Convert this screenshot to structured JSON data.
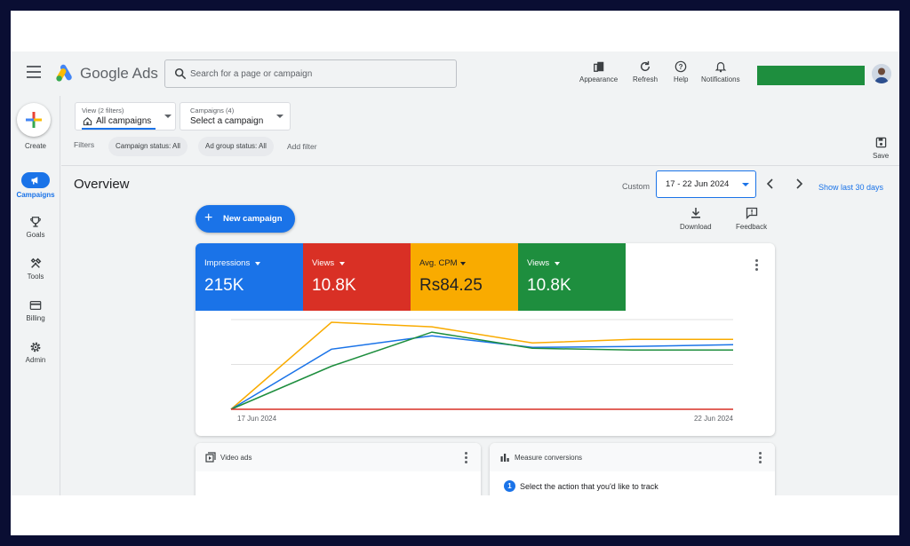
{
  "colors": {
    "accent": "#1a73e8",
    "impressions": "#1a73e8",
    "views_red": "#d93025",
    "avg_cpm": "#f9ab00",
    "views_green": "#1e8e3e"
  },
  "header": {
    "brand": "Google Ads",
    "search_placeholder": "Search for a page or campaign",
    "actions": [
      {
        "label": "Appearance",
        "icon": "appearance-icon"
      },
      {
        "label": "Refresh",
        "icon": "refresh-icon"
      },
      {
        "label": "Help",
        "icon": "help-icon"
      },
      {
        "label": "Notifications",
        "icon": "bell-icon"
      }
    ]
  },
  "leftnav": {
    "create": "Create",
    "items": [
      {
        "label": "Campaigns",
        "icon": "megaphone-icon",
        "active": true
      },
      {
        "label": "Goals",
        "icon": "trophy-icon"
      },
      {
        "label": "Tools",
        "icon": "tools-icon"
      },
      {
        "label": "Billing",
        "icon": "card-icon"
      },
      {
        "label": "Admin",
        "icon": "gear-icon"
      }
    ]
  },
  "filters": {
    "view_label": "View (2 filters)",
    "view_value": "All campaigns",
    "campaigns_label": "Campaigns (4)",
    "campaigns_value": "Select a campaign",
    "filters_label": "Filters",
    "chips": [
      "Campaign status: All",
      "Ad group status: All"
    ],
    "add_filter": "Add filter",
    "save": "Save"
  },
  "overview": {
    "title": "Overview",
    "custom": "Custom",
    "date_range": "17 - 22 Jun 2024",
    "show_last": "Show last 30 days",
    "new_campaign": "New campaign",
    "download": "Download",
    "feedback": "Feedback"
  },
  "metrics": [
    {
      "label": "Impressions",
      "value": "215K"
    },
    {
      "label": "Views",
      "value": "10.8K"
    },
    {
      "label": "Avg. CPM",
      "value": "Rs84.25"
    },
    {
      "label": "Views",
      "value": "10.8K"
    }
  ],
  "chart_data": {
    "type": "line",
    "x": [
      "17 Jun 2024",
      "18 Jun 2024",
      "19 Jun 2024",
      "20 Jun 2024",
      "21 Jun 2024",
      "22 Jun 2024"
    ],
    "x_tick_labels": [
      "17 Jun 2024",
      "22 Jun 2024"
    ],
    "ylim": [
      0,
      1
    ],
    "grid": true,
    "series": [
      {
        "color": "#f9ab00",
        "values": [
          0,
          0.97,
          0.92,
          0.74,
          0.78,
          0.78
        ]
      },
      {
        "color": "#1a73e8",
        "values": [
          0,
          0.67,
          0.82,
          0.69,
          0.7,
          0.72
        ]
      },
      {
        "color": "#1e8e3e",
        "values": [
          0,
          0.48,
          0.86,
          0.68,
          0.66,
          0.66
        ]
      },
      {
        "color": "#d93025",
        "values": [
          0,
          0,
          0,
          0,
          0,
          0
        ]
      }
    ]
  },
  "cards": {
    "video_ads": "Video ads",
    "measure_conversions": "Measure conversions",
    "step_number": "1",
    "step_text": "Select the action that you'd like to track"
  }
}
